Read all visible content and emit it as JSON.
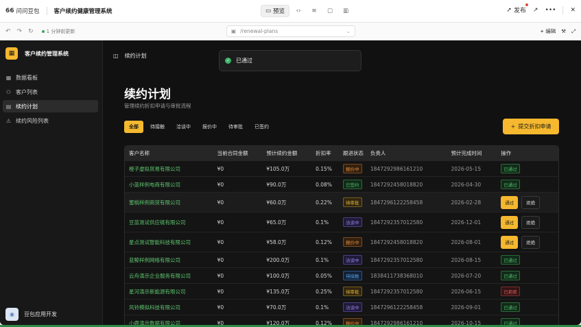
{
  "topbar": {
    "brand": "问问豆包",
    "app_name": "客户续约健康管理系统",
    "preview_label": "预览",
    "publish_label": "发布"
  },
  "subbar": {
    "saved_text": "1 分钟前更新",
    "url": "/renewal-plans",
    "edit_label": "编辑"
  },
  "sidebar": {
    "title": "客户续约管理系统",
    "items": [
      {
        "label": "数据看板",
        "icon": "grid-icon"
      },
      {
        "label": "客户列表",
        "icon": "users-icon"
      },
      {
        "label": "续约计划",
        "icon": "clipboard-icon"
      },
      {
        "label": "续约风险列表",
        "icon": "warning-icon"
      }
    ],
    "active_index": 2,
    "user_label": "豆包应用开发"
  },
  "main": {
    "breadcrumb": "续约计划",
    "toast": "已通过",
    "title": "续约计划",
    "subtitle": "管理续约折扣申请与审批流程",
    "tabs": [
      "全部",
      "待接触",
      "洽谈中",
      "报价中",
      "待审批",
      "已签约"
    ],
    "active_tab": 0,
    "submit_label": "提交折扣申请"
  },
  "table": {
    "columns": [
      "客户名称",
      "当前合同金额",
      "预计续约金额",
      "折扣率",
      "跟进状态",
      "负责人",
      "预计完成时间",
      "操作"
    ],
    "pass_label": "通过",
    "reject_label": "拒绝",
    "rows": [
      {
        "name": "橙子虚拟贸易有限公司",
        "current": "¥0",
        "expected": "¥105.0万",
        "discount": "0.15%",
        "status": "报价中",
        "status_color": "orange",
        "owner": "1847292986161210",
        "date": "2026-05-15",
        "action": "已通过",
        "action_color": "green"
      },
      {
        "name": "小蓝样例电商有限公司",
        "current": "¥0",
        "expected": "¥90.0万",
        "discount": "0.08%",
        "status": "已签约",
        "status_color": "green",
        "owner": "1847292458018820",
        "date": "2026-04-30",
        "action": "已通过",
        "action_color": "green"
      },
      {
        "name": "蜜桃样例商贸有限公司",
        "current": "¥0",
        "expected": "¥60.0万",
        "discount": "0.22%",
        "status": "待审批",
        "status_color": "yellow",
        "owner": "1847296122258458",
        "date": "2026-02-28",
        "action": "buttons"
      },
      {
        "name": "豆苗测试供应链有限公司",
        "current": "¥0",
        "expected": "¥65.0万",
        "discount": "0.1%",
        "status": "洽谈中",
        "status_color": "purple",
        "owner": "1847292357012580",
        "date": "2026-12-01",
        "action": "buttons"
      },
      {
        "name": "星点测试智能科技有限公司",
        "current": "¥0",
        "expected": "¥58.0万",
        "discount": "0.12%",
        "status": "报价中",
        "status_color": "orange",
        "owner": "1847292458018820",
        "date": "2026-08-01",
        "action": "buttons"
      },
      {
        "name": "蓝鲸样例网络有限公司",
        "current": "¥0",
        "expected": "¥200.0万",
        "discount": "0.1%",
        "status": "洽谈中",
        "status_color": "purple",
        "owner": "1847292357012580",
        "date": "2026-08-15",
        "action": "已通过",
        "action_color": "green"
      },
      {
        "name": "云舟演示企业服务有限公司",
        "current": "¥0",
        "expected": "¥100.0万",
        "discount": "0.05%",
        "status": "待接触",
        "status_color": "blue",
        "owner": "1838411738368010",
        "date": "2026-07-20",
        "action": "已通过",
        "action_color": "green"
      },
      {
        "name": "星河演示新能源有限公司",
        "current": "¥0",
        "expected": "¥135.0万",
        "discount": "0.25%",
        "status": "待审批",
        "status_color": "yellow",
        "owner": "1847292357012580",
        "date": "2026-06-15",
        "action": "已拒绝",
        "action_color": "red"
      },
      {
        "name": "风铃模拟科技有限公司",
        "current": "¥0",
        "expected": "¥70.0万",
        "discount": "0.1%",
        "status": "洽谈中",
        "status_color": "purple",
        "owner": "1847296122258458",
        "date": "2026-09-01",
        "action": "已通过",
        "action_color": "green"
      },
      {
        "name": "小鹿演示数据有限公司",
        "current": "¥0",
        "expected": "¥120.0万",
        "discount": "0.12%",
        "status": "报价中",
        "status_color": "orange",
        "owner": "1847292986161210",
        "date": "2026-10-15",
        "action": "已通过",
        "action_color": "green"
      }
    ]
  }
}
